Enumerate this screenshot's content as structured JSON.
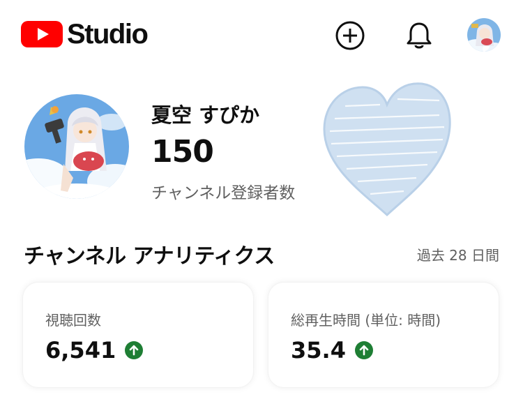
{
  "app": {
    "logo_text": "Studio"
  },
  "header": {
    "create_icon": "create-plus-icon",
    "notifications_icon": "bell-icon",
    "account_icon": "avatar"
  },
  "channel": {
    "name": "夏空 すぴか",
    "subscriber_count": "150",
    "subscriber_label": "チャンネル登録者数"
  },
  "analytics": {
    "title": "チャンネル アナリティクス",
    "period": "過去 28 日間",
    "cards": [
      {
        "label": "視聴回数",
        "value": "6,541",
        "trend": "up"
      },
      {
        "label": "総再生時間 (単位: 時間)",
        "value": "35.4",
        "trend": "up"
      }
    ]
  },
  "colors": {
    "brand_red": "#ff0000",
    "trend_green": "#1e7e34",
    "secondary_text": "#606060",
    "heart_sticker": "#c9dcee"
  }
}
